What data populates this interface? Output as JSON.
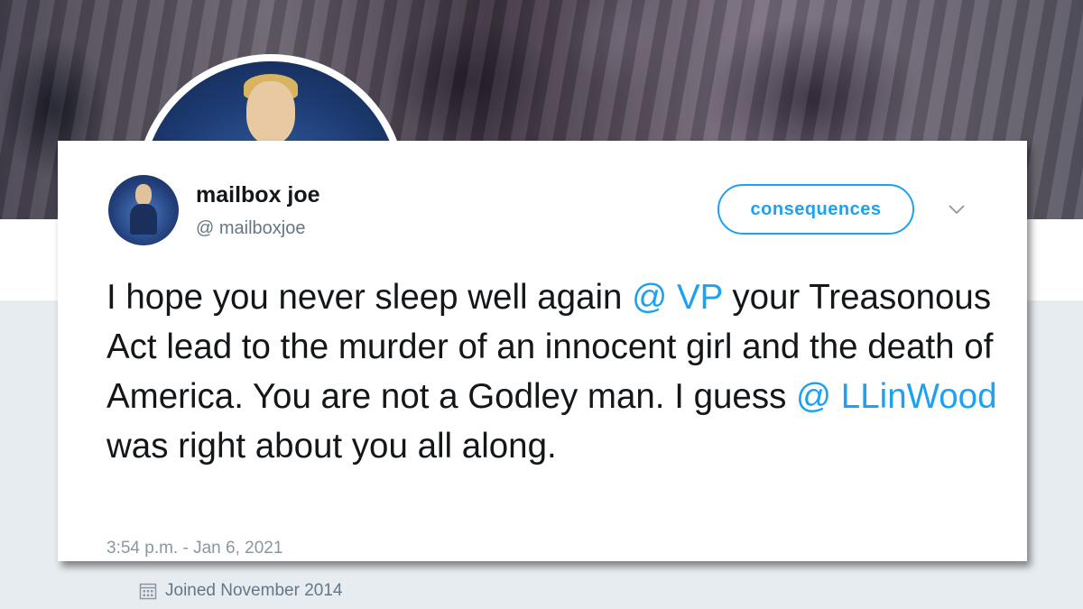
{
  "tweet": {
    "display_name": "mailbox joe",
    "handle": "@ mailboxjoe",
    "button_label": "consequences",
    "text_segments": [
      {
        "text": "I hope you never sleep well again ",
        "type": "plain"
      },
      {
        "text": "@ VP",
        "type": "mention"
      },
      {
        "text": " your Treasonous Act lead to the murder of an innocent girl and the death of America. You are not a Godley man. I guess ",
        "type": "plain"
      },
      {
        "text": "@ LLinWood",
        "type": "mention"
      },
      {
        "text": " was right about you all along.",
        "type": "plain"
      }
    ],
    "timestamp": "3:54 p.m. - Jan 6, 2021"
  },
  "profile": {
    "joined": "Joined November 2014"
  },
  "icons": {
    "menu": "chevron-down-icon",
    "joined": "calendar-icon"
  },
  "colors": {
    "link": "#1da1f2",
    "text": "#14171a",
    "muted": "#657786",
    "background": "#e6ecf0"
  }
}
